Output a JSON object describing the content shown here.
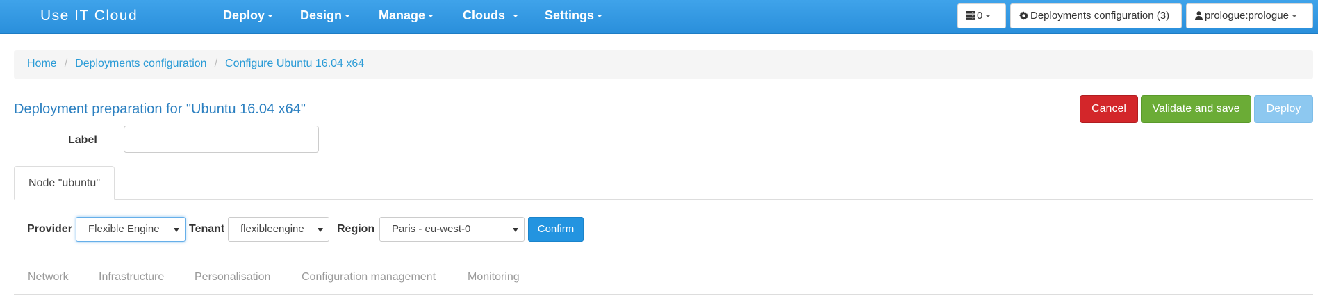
{
  "navbar": {
    "brand": "Use IT Cloud",
    "menu": [
      {
        "label": "Deploy"
      },
      {
        "label": "Design"
      },
      {
        "label": "Manage"
      },
      {
        "label": "Clouds"
      },
      {
        "label": "Settings"
      }
    ],
    "server_count": "0",
    "deployments_config_label": "Deployments configuration (3)",
    "user_label": "prologue:prologue"
  },
  "breadcrumb": {
    "items": [
      "Home",
      "Deployments configuration",
      "Configure Ubuntu 16.04 x64"
    ]
  },
  "page": {
    "title": "Deployment preparation for \"Ubuntu 16.04 x64\"",
    "label_field": {
      "label": "Label",
      "value": ""
    }
  },
  "actions": {
    "cancel": "Cancel",
    "validate": "Validate and save",
    "deploy": "Deploy"
  },
  "node_tab": "Node \"ubuntu\"",
  "provider_row": {
    "provider_label": "Provider",
    "provider_value": "Flexible Engine",
    "tenant_label": "Tenant",
    "tenant_value": "flexibleengine",
    "region_label": "Region",
    "region_value": "Paris - eu-west-0",
    "confirm": "Confirm"
  },
  "subtabs": [
    "Network",
    "Infrastructure",
    "Personalisation",
    "Configuration management",
    "Monitoring"
  ],
  "colors": {
    "navbar": "#2a8fdb",
    "cancel": "#d3262a",
    "validate": "#6bac36",
    "deploy": "#8dc8f0",
    "confirm": "#2394e0",
    "title": "#2a7fc0",
    "link": "#2a9bd6"
  }
}
